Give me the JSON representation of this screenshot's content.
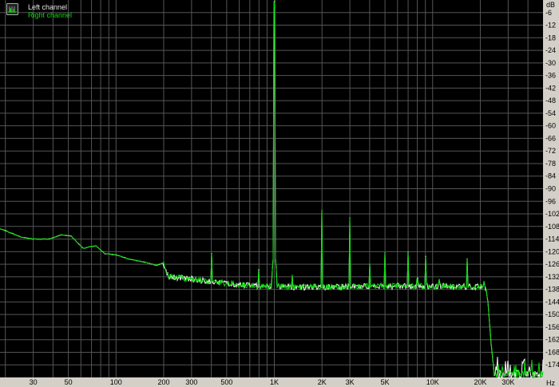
{
  "chart_data": {
    "type": "line",
    "title": "",
    "xlabel": "Hz",
    "ylabel": "dB",
    "xscale": "log",
    "xlim": [
      18.5,
      49800
    ],
    "ylim": [
      -180,
      0
    ],
    "grid": true,
    "legend_position": "top-left",
    "x_tick_labels": [
      {
        "f": 30,
        "label": "30"
      },
      {
        "f": 50,
        "label": "50"
      },
      {
        "f": 100,
        "label": "100"
      },
      {
        "f": 200,
        "label": "200"
      },
      {
        "f": 300,
        "label": "300"
      },
      {
        "f": 500,
        "label": "500"
      },
      {
        "f": 1000,
        "label": "1K"
      },
      {
        "f": 2000,
        "label": "2K"
      },
      {
        "f": 3000,
        "label": "3K"
      },
      {
        "f": 5000,
        "label": "5K"
      },
      {
        "f": 10000,
        "label": "10K"
      },
      {
        "f": 20000,
        "label": "20K"
      },
      {
        "f": 30000,
        "label": "30K"
      }
    ],
    "y_ticks": [
      -6,
      -12,
      -18,
      -24,
      -30,
      -36,
      -42,
      -48,
      -54,
      -60,
      -66,
      -72,
      -78,
      -84,
      -90,
      -96,
      -102,
      -108,
      -114,
      -120,
      -126,
      -132,
      -138,
      -144,
      -150,
      -156,
      -162,
      -168,
      -174
    ],
    "noise_floor": [
      [
        18.5,
        -109
      ],
      [
        25,
        -113
      ],
      [
        30,
        -114
      ],
      [
        38,
        -114
      ],
      [
        45,
        -112
      ],
      [
        52,
        -112.5
      ],
      [
        62,
        -118.5
      ],
      [
        70,
        -117.5
      ],
      [
        75,
        -117.3
      ],
      [
        85,
        -121
      ],
      [
        100,
        -121.5
      ],
      [
        120,
        -123.5
      ],
      [
        150,
        -125
      ],
      [
        180,
        -126.5
      ],
      [
        198,
        -125.5
      ],
      [
        215,
        -132
      ],
      [
        300,
        -133
      ],
      [
        400,
        -134.5
      ],
      [
        550,
        -135.5
      ],
      [
        800,
        -136.5
      ],
      [
        1500,
        -137
      ],
      [
        5000,
        -136.5
      ],
      [
        12000,
        -136.5
      ],
      [
        20000,
        -136.8
      ],
      [
        21500,
        -137
      ],
      [
        22300,
        -143
      ],
      [
        23500,
        -165
      ],
      [
        24500,
        -178.5
      ],
      [
        49800,
        -178.5
      ]
    ],
    "series": [
      {
        "name": "Left channel",
        "color": "#ffffff"
      },
      {
        "name": "Right channel",
        "color": "#00e000"
      }
    ],
    "harmonic_peaks": [
      [
        400,
        -121
      ],
      [
        800,
        -129
      ],
      [
        1000,
        -1
      ],
      [
        1300,
        -131
      ],
      [
        2000,
        -100
      ],
      [
        3000,
        -104
      ],
      [
        4000,
        -126
      ],
      [
        5000,
        -120.5
      ],
      [
        7000,
        -120.5
      ],
      [
        8000,
        -133
      ],
      [
        9000,
        -122.5
      ],
      [
        11000,
        -133
      ],
      [
        16500,
        -123.5
      ],
      [
        21000,
        -134
      ]
    ]
  }
}
